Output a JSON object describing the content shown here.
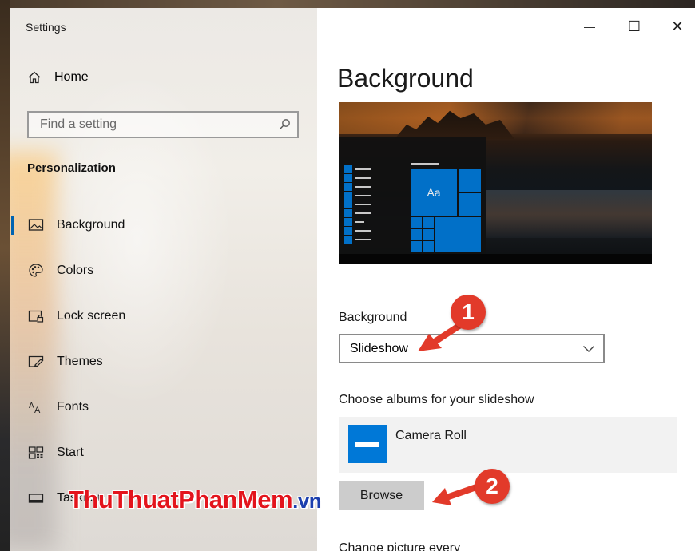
{
  "window": {
    "title": "Settings"
  },
  "sidebar": {
    "home_label": "Home",
    "search_placeholder": "Find a setting",
    "section_title": "Personalization",
    "items": [
      {
        "label": "Background",
        "icon": "picture-icon",
        "active": true
      },
      {
        "label": "Colors",
        "icon": "palette-icon",
        "active": false
      },
      {
        "label": "Lock screen",
        "icon": "lock-screen-icon",
        "active": false
      },
      {
        "label": "Themes",
        "icon": "themes-icon",
        "active": false
      },
      {
        "label": "Fonts",
        "icon": "fonts-icon",
        "active": false
      },
      {
        "label": "Start",
        "icon": "start-icon",
        "active": false
      },
      {
        "label": "Taskbar",
        "icon": "taskbar-icon",
        "active": false
      }
    ]
  },
  "title_bar": {
    "minimize_glyph": "—",
    "maximize_glyph": "☐",
    "close_glyph": "✕"
  },
  "main": {
    "page_title": "Background",
    "preview": {
      "sample_text": "Aa"
    },
    "background_label": "Background",
    "background_value": "Slideshow",
    "albums_label": "Choose albums for your slideshow",
    "album_name": "Camera Roll",
    "browse_label": "Browse",
    "change_label": "Change picture every"
  },
  "annotations": {
    "step1": "1",
    "step2": "2"
  },
  "watermark": {
    "main": "ThuThuatPhanMem",
    "suffix": ".vn"
  },
  "colors": {
    "accent": "#0078d7",
    "marker": "#e23a2a",
    "watermark_red": "#e3141c",
    "watermark_blue": "#1c3fae"
  }
}
